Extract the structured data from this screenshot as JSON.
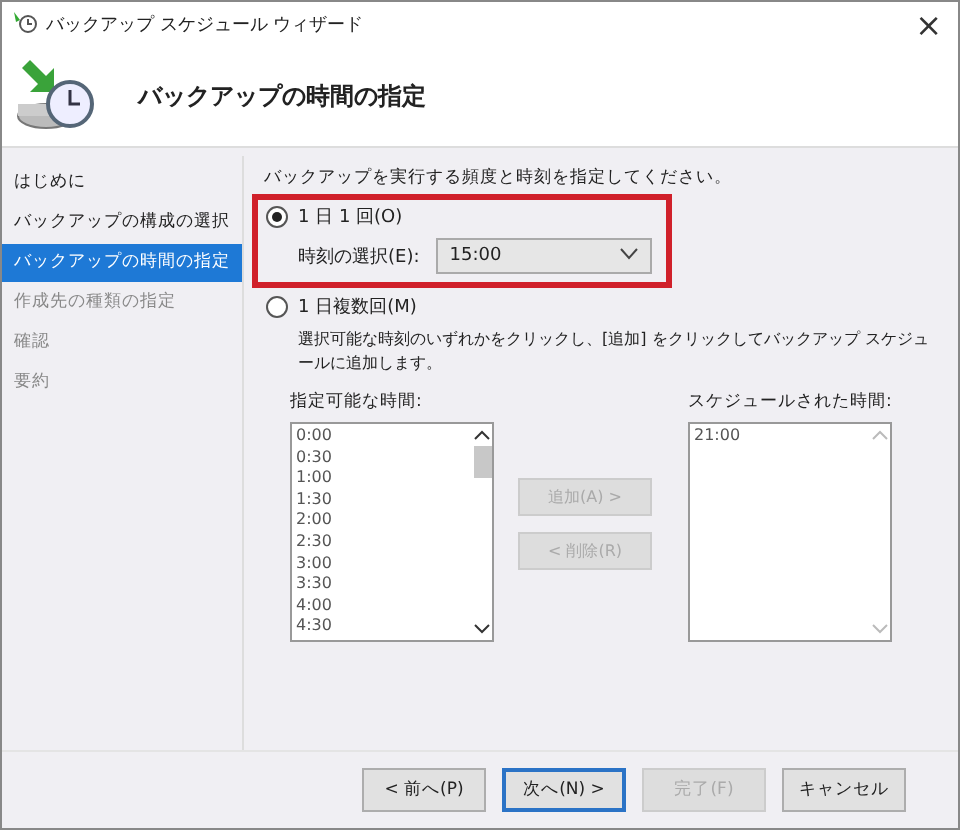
{
  "window": {
    "title": "バックアップ スケジュール ウィザード",
    "close": "×"
  },
  "header": {
    "title": "バックアップの時間の指定"
  },
  "sidebar": {
    "items": [
      {
        "label": "はじめに",
        "selected": false,
        "disabled": false
      },
      {
        "label": "バックアップの構成の選択",
        "selected": false,
        "disabled": false
      },
      {
        "label": "バックアップの時間の指定",
        "selected": true,
        "disabled": false
      },
      {
        "label": "作成先の種類の指定",
        "selected": false,
        "disabled": true
      },
      {
        "label": "確認",
        "selected": false,
        "disabled": true
      },
      {
        "label": "要約",
        "selected": false,
        "disabled": true
      }
    ]
  },
  "content": {
    "instruction": "バックアップを実行する頻度と時刻を指定してください。",
    "options": [
      {
        "label": "1 日 1 回(O)",
        "selected": true,
        "highlighted": true,
        "time_label": "時刻の選択(E):",
        "time_value": "15:00"
      },
      {
        "label": "1 日複数回(M)",
        "selected": false,
        "highlighted": false,
        "description": "選択可能な時刻のいずれかをクリックし、[追加] をクリックしてバックアップ スケジュールに追加します。"
      }
    ],
    "available": {
      "label": "指定可能な時間:",
      "items": [
        "0:00",
        "0:30",
        "1:00",
        "1:30",
        "2:00",
        "2:30",
        "3:00",
        "3:30",
        "4:00",
        "4:30"
      ]
    },
    "add_button": {
      "label": "追加(A) >",
      "disabled": true
    },
    "remove_button": {
      "label": "< 削除(R)",
      "disabled": true
    },
    "scheduled": {
      "label": "スケジュールされた時間:",
      "items": [
        "21:00"
      ]
    }
  },
  "buttons": [
    {
      "label": "< 前へ(P)",
      "disabled": false,
      "default": false
    },
    {
      "label": "次へ(N) >",
      "disabled": false,
      "default": true
    },
    {
      "label": "完了(F)",
      "disabled": true,
      "default": false
    },
    {
      "label": "キャンセル",
      "disabled": false,
      "default": false
    }
  ]
}
